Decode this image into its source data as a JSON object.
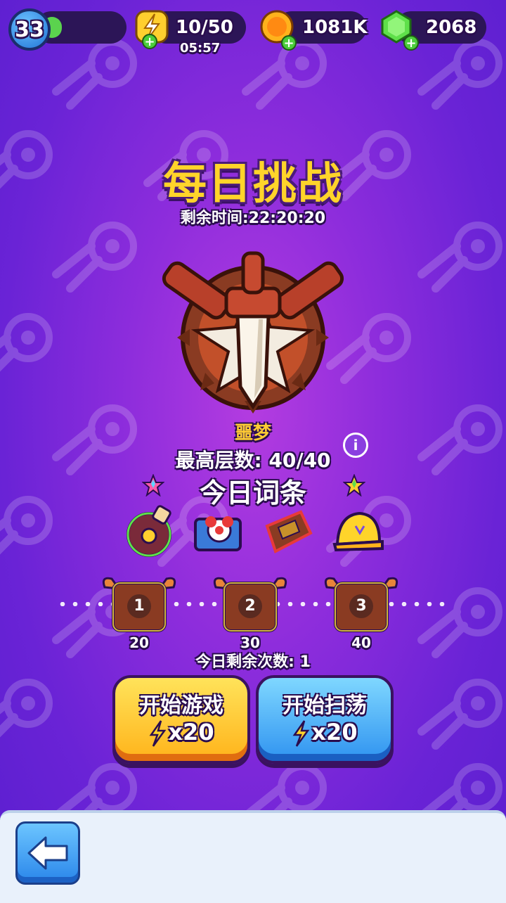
{
  "topbar": {
    "level": "33",
    "xp_fraction": 0.25,
    "energy": "10/50",
    "energy_timer": "05:57",
    "coins": "1081K",
    "gems": "2068",
    "plus_symbol": "+"
  },
  "challenge": {
    "title": "每日挑战",
    "time_remaining": "剩余时间:22:20:20",
    "difficulty": "噩梦",
    "best_floors": "最高层数: 40/40",
    "info_symbol": "i",
    "modifiers_title": "今日词条",
    "modifiers": [
      "potion-modifier-icon",
      "gift-box-modifier-icon",
      "wooden-board-modifier-icon",
      "helmet-modifier-icon"
    ]
  },
  "rewards": {
    "chests": [
      {
        "number": "1",
        "floor": "20"
      },
      {
        "number": "2",
        "floor": "30"
      },
      {
        "number": "3",
        "floor": "40"
      }
    ],
    "remaining_attempts": "今日剩余次数: 1"
  },
  "buttons": {
    "start_label": "开始游戏",
    "start_cost": "x20",
    "sweep_label": "开始扫荡",
    "sweep_cost": "x20"
  },
  "colors": {
    "background": "#8e2ddc",
    "title": "#ffd42a",
    "start_button": "#ffc52a",
    "sweep_button": "#3aa0f2"
  }
}
